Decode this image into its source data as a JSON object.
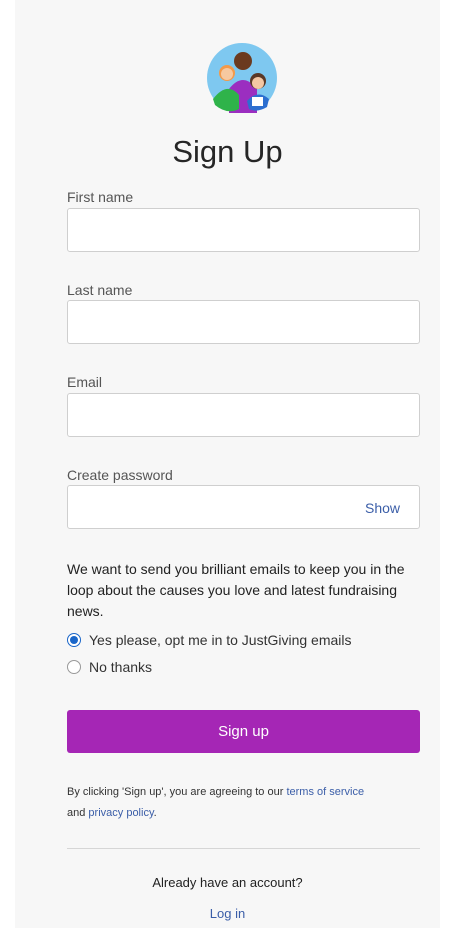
{
  "title": "Sign Up",
  "fields": {
    "first_name": {
      "label": "First name",
      "value": ""
    },
    "last_name": {
      "label": "Last name",
      "value": ""
    },
    "email": {
      "label": "Email",
      "value": ""
    },
    "password": {
      "label": "Create password",
      "value": "",
      "show_label": "Show"
    }
  },
  "marketing": {
    "text": "We want to send you brilliant emails to keep you in the loop about the causes you love and latest fundraising news.",
    "options": [
      {
        "label": "Yes please, opt me in to JustGiving emails",
        "checked": true
      },
      {
        "label": "No thanks",
        "checked": false
      }
    ]
  },
  "signup_button": "Sign up",
  "legal": {
    "prefix": "By clicking 'Sign up', you are agreeing to our ",
    "terms_link": "terms of service",
    "and": "and ",
    "privacy_link": "privacy policy",
    "suffix": "."
  },
  "footer": {
    "question": "Already have an account?",
    "login_link": "Log in"
  },
  "colors": {
    "primary": "#a526b5",
    "link": "#3b5ea8",
    "radio": "#1a66c9"
  }
}
